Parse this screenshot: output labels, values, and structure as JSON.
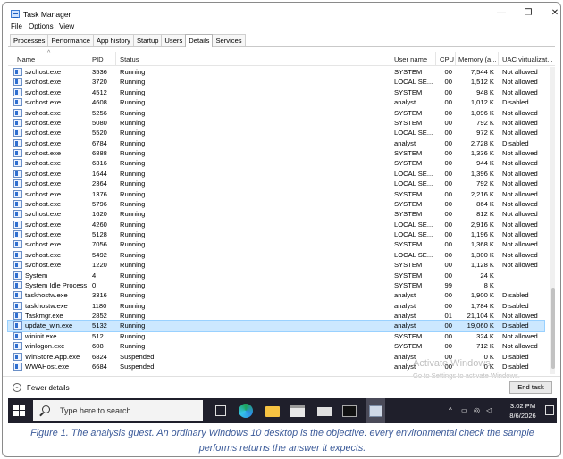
{
  "window": {
    "title": "Task Manager",
    "controls": {
      "min": "—",
      "max": "❐",
      "close": "✕"
    }
  },
  "menu": [
    "File",
    "Options",
    "View"
  ],
  "tabs": [
    "Processes",
    "Performance",
    "App history",
    "Startup",
    "Users",
    "Details",
    "Services"
  ],
  "active_tab": "Details",
  "columns": {
    "name": "Name",
    "pid": "PID",
    "status": "Status",
    "user": "User name",
    "cpu": "CPU",
    "memory": "Memory (a...",
    "uac": "UAC virtualizat..."
  },
  "rows": [
    {
      "name": "svchost.exe",
      "pid": "3536",
      "status": "Running",
      "user": "SYSTEM",
      "cpu": "00",
      "mem": "7,544 K",
      "uac": "Not allowed"
    },
    {
      "name": "svchost.exe",
      "pid": "3720",
      "status": "Running",
      "user": "LOCAL SE...",
      "cpu": "00",
      "mem": "1,512 K",
      "uac": "Not allowed"
    },
    {
      "name": "svchost.exe",
      "pid": "4512",
      "status": "Running",
      "user": "SYSTEM",
      "cpu": "00",
      "mem": "948 K",
      "uac": "Not allowed"
    },
    {
      "name": "svchost.exe",
      "pid": "4608",
      "status": "Running",
      "user": "analyst",
      "cpu": "00",
      "mem": "1,012 K",
      "uac": "Disabled"
    },
    {
      "name": "svchost.exe",
      "pid": "5256",
      "status": "Running",
      "user": "SYSTEM",
      "cpu": "00",
      "mem": "1,096 K",
      "uac": "Not allowed"
    },
    {
      "name": "svchost.exe",
      "pid": "5080",
      "status": "Running",
      "user": "SYSTEM",
      "cpu": "00",
      "mem": "792 K",
      "uac": "Not allowed"
    },
    {
      "name": "svchost.exe",
      "pid": "5520",
      "status": "Running",
      "user": "LOCAL SE...",
      "cpu": "00",
      "mem": "972 K",
      "uac": "Not allowed"
    },
    {
      "name": "svchost.exe",
      "pid": "6784",
      "status": "Running",
      "user": "analyst",
      "cpu": "00",
      "mem": "2,728 K",
      "uac": "Disabled"
    },
    {
      "name": "svchost.exe",
      "pid": "6888",
      "status": "Running",
      "user": "SYSTEM",
      "cpu": "00",
      "mem": "1,336 K",
      "uac": "Not allowed"
    },
    {
      "name": "svchost.exe",
      "pid": "6316",
      "status": "Running",
      "user": "SYSTEM",
      "cpu": "00",
      "mem": "944 K",
      "uac": "Not allowed"
    },
    {
      "name": "svchost.exe",
      "pid": "1644",
      "status": "Running",
      "user": "LOCAL SE...",
      "cpu": "00",
      "mem": "1,396 K",
      "uac": "Not allowed"
    },
    {
      "name": "svchost.exe",
      "pid": "2364",
      "status": "Running",
      "user": "LOCAL SE...",
      "cpu": "00",
      "mem": "792 K",
      "uac": "Not allowed"
    },
    {
      "name": "svchost.exe",
      "pid": "1376",
      "status": "Running",
      "user": "SYSTEM",
      "cpu": "00",
      "mem": "2,216 K",
      "uac": "Not allowed"
    },
    {
      "name": "svchost.exe",
      "pid": "5796",
      "status": "Running",
      "user": "SYSTEM",
      "cpu": "00",
      "mem": "864 K",
      "uac": "Not allowed"
    },
    {
      "name": "svchost.exe",
      "pid": "1620",
      "status": "Running",
      "user": "SYSTEM",
      "cpu": "00",
      "mem": "812 K",
      "uac": "Not allowed"
    },
    {
      "name": "svchost.exe",
      "pid": "4260",
      "status": "Running",
      "user": "LOCAL SE...",
      "cpu": "00",
      "mem": "2,916 K",
      "uac": "Not allowed"
    },
    {
      "name": "svchost.exe",
      "pid": "5128",
      "status": "Running",
      "user": "LOCAL SE...",
      "cpu": "00",
      "mem": "1,196 K",
      "uac": "Not allowed"
    },
    {
      "name": "svchost.exe",
      "pid": "7056",
      "status": "Running",
      "user": "SYSTEM",
      "cpu": "00",
      "mem": "1,368 K",
      "uac": "Not allowed"
    },
    {
      "name": "svchost.exe",
      "pid": "5492",
      "status": "Running",
      "user": "LOCAL SE...",
      "cpu": "00",
      "mem": "1,300 K",
      "uac": "Not allowed"
    },
    {
      "name": "svchost.exe",
      "pid": "1220",
      "status": "Running",
      "user": "SYSTEM",
      "cpu": "00",
      "mem": "1,128 K",
      "uac": "Not allowed"
    },
    {
      "name": "System",
      "pid": "4",
      "status": "Running",
      "user": "SYSTEM",
      "cpu": "00",
      "mem": "24 K",
      "uac": ""
    },
    {
      "name": "System Idle Process",
      "pid": "0",
      "status": "Running",
      "user": "SYSTEM",
      "cpu": "99",
      "mem": "8 K",
      "uac": ""
    },
    {
      "name": "taskhostw.exe",
      "pid": "3316",
      "status": "Running",
      "user": "analyst",
      "cpu": "00",
      "mem": "1,900 K",
      "uac": "Disabled"
    },
    {
      "name": "taskhostw.exe",
      "pid": "1180",
      "status": "Running",
      "user": "analyst",
      "cpu": "00",
      "mem": "1,784 K",
      "uac": "Disabled"
    },
    {
      "name": "Taskmgr.exe",
      "pid": "2852",
      "status": "Running",
      "user": "analyst",
      "cpu": "01",
      "mem": "21,104 K",
      "uac": "Not allowed"
    },
    {
      "name": "update_win.exe",
      "pid": "5132",
      "status": "Running",
      "user": "analyst",
      "cpu": "00",
      "mem": "19,060 K",
      "uac": "Disabled",
      "selected": true
    },
    {
      "name": "wininit.exe",
      "pid": "512",
      "status": "Running",
      "user": "SYSTEM",
      "cpu": "00",
      "mem": "324 K",
      "uac": "Not allowed"
    },
    {
      "name": "winlogon.exe",
      "pid": "608",
      "status": "Running",
      "user": "SYSTEM",
      "cpu": "00",
      "mem": "712 K",
      "uac": "Not allowed"
    },
    {
      "name": "WinStore.App.exe",
      "pid": "6824",
      "status": "Suspended",
      "user": "analyst",
      "cpu": "00",
      "mem": "0 K",
      "uac": "Disabled"
    },
    {
      "name": "WWAHost.exe",
      "pid": "6684",
      "status": "Suspended",
      "user": "analyst",
      "cpu": "00",
      "mem": "0 K",
      "uac": "Disabled"
    }
  ],
  "footer": {
    "fewer_details": "Fewer details",
    "end_task": "End task"
  },
  "watermark": {
    "line1": "Activate Windows",
    "line2": "Go to Settings to activate Windows."
  },
  "taskbar": {
    "search_placeholder": "Type here to search",
    "time": "3:02 PM",
    "date": "8/6/2026"
  },
  "caption": "Figure 1. The analysis guest. An ordinary Windows 10 desktop is the objective: every environmental check the sample performs returns the answer it expects."
}
